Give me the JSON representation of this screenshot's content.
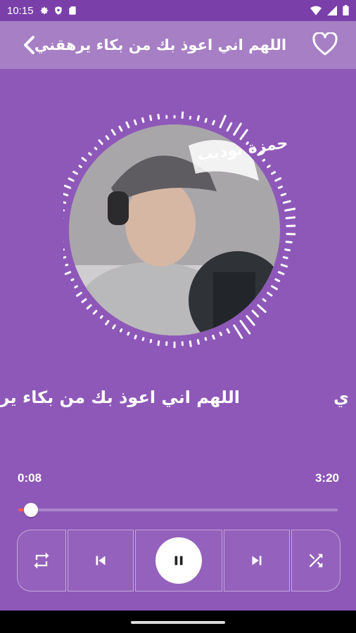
{
  "status_bar": {
    "time": "10:15",
    "icons": [
      "settings-icon",
      "shield-icon",
      "sd-card-icon",
      "wifi-icon",
      "signal-icon",
      "battery-icon"
    ]
  },
  "app_bar": {
    "title": "اللهم اني اعوذ بك من بكاء يرهقني",
    "back_icon": "chevron-left-icon",
    "favorite_icon": "heart-outline-icon"
  },
  "album_art": {
    "overlay_text": "حمزة بوديب"
  },
  "now_playing": {
    "marquee_main": "اللهم اني اعوذ بك من بكاء يرهقن",
    "marquee_wrap": "ي"
  },
  "progress": {
    "current": "0:08",
    "total": "3:20",
    "fraction": 0.04
  },
  "controls": {
    "repeat_icon": "repeat-icon",
    "previous_icon": "skip-previous-icon",
    "play_state_icon": "pause-icon",
    "next_icon": "skip-next-icon",
    "shuffle_icon": "shuffle-icon"
  },
  "colors": {
    "background": "#8e58b8",
    "app_bar": "#a77fc4",
    "status_bar": "#7a3fa9",
    "progress_fill": "#ff5a4f"
  }
}
